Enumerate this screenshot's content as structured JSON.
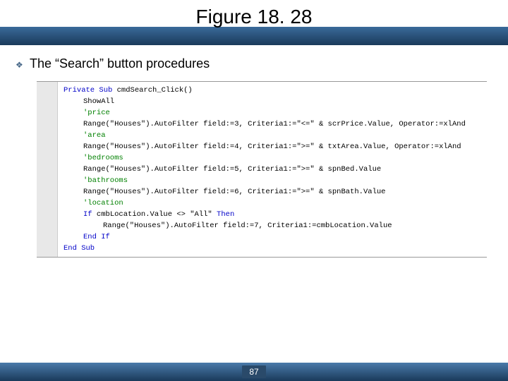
{
  "header": {
    "title": "Figure 18. 28"
  },
  "bullet": {
    "icon": "❖",
    "text": "The “Search” button procedures"
  },
  "code": {
    "lines": [
      {
        "cls": "",
        "segs": [
          {
            "t": "Private Sub",
            "c": "kw"
          },
          {
            "t": " cmdSearch_Click()",
            "c": "txt"
          }
        ]
      },
      {
        "cls": "indent1",
        "segs": [
          {
            "t": "ShowAll",
            "c": "txt"
          }
        ]
      },
      {
        "cls": "indent1",
        "segs": [
          {
            "t": "'price",
            "c": "cm"
          }
        ]
      },
      {
        "cls": "indent1",
        "segs": [
          {
            "t": "Range(\"Houses\").AutoFilter field:=3, Criteria1:=\"<=\" & scrPrice.Value, Operator:=xlAnd",
            "c": "txt"
          }
        ]
      },
      {
        "cls": "indent1",
        "segs": [
          {
            "t": "'area",
            "c": "cm"
          }
        ]
      },
      {
        "cls": "indent1",
        "segs": [
          {
            "t": "Range(\"Houses\").AutoFilter field:=4, Criteria1:=\">=\" & txtArea.Value, Operator:=xlAnd",
            "c": "txt"
          }
        ]
      },
      {
        "cls": "indent1",
        "segs": [
          {
            "t": "'bedrooms",
            "c": "cm"
          }
        ]
      },
      {
        "cls": "indent1",
        "segs": [
          {
            "t": "Range(\"Houses\").AutoFilter field:=5, Criteria1:=\">=\" & spnBed.Value",
            "c": "txt"
          }
        ]
      },
      {
        "cls": "indent1",
        "segs": [
          {
            "t": "'bathrooms",
            "c": "cm"
          }
        ]
      },
      {
        "cls": "indent1",
        "segs": [
          {
            "t": "Range(\"Houses\").AutoFilter field:=6, Criteria1:=\">=\" & spnBath.Value",
            "c": "txt"
          }
        ]
      },
      {
        "cls": "indent1",
        "segs": [
          {
            "t": "'location",
            "c": "cm"
          }
        ]
      },
      {
        "cls": "indent1",
        "segs": [
          {
            "t": "If",
            "c": "kw"
          },
          {
            "t": " cmbLocation.Value <> \"All\" ",
            "c": "txt"
          },
          {
            "t": "Then",
            "c": "kw"
          }
        ]
      },
      {
        "cls": "indent2",
        "segs": [
          {
            "t": "Range(\"Houses\").AutoFilter field:=7, Criteria1:=cmbLocation.Value",
            "c": "txt"
          }
        ]
      },
      {
        "cls": "indent1",
        "segs": [
          {
            "t": "End If",
            "c": "kw"
          }
        ]
      },
      {
        "cls": "",
        "segs": [
          {
            "t": "End Sub",
            "c": "kw"
          }
        ]
      }
    ]
  },
  "footer": {
    "page": "87"
  }
}
